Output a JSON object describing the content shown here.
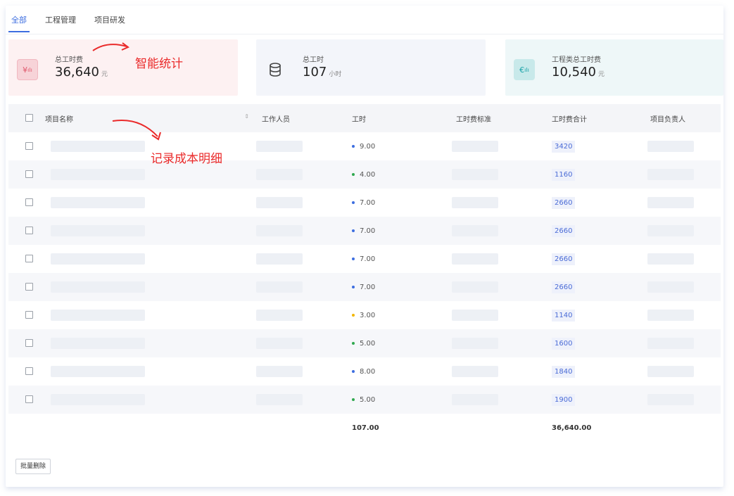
{
  "tabs": [
    "全部",
    "工程管理",
    "项目研发"
  ],
  "stats": [
    {
      "label": "总工时费",
      "value": "36,640",
      "unit": "元",
      "icon": "finance-icon"
    },
    {
      "label": "总工时",
      "value": "107",
      "unit": "小时",
      "icon": "database-icon"
    },
    {
      "label": "工程类总工时费",
      "value": "10,540",
      "unit": "元",
      "icon": "cost-trend-icon"
    }
  ],
  "table": {
    "columns": [
      "项目名称",
      "工作人员",
      "工时",
      "工时费标准",
      "工时费合计",
      "项目负责人"
    ],
    "rows": [
      {
        "hours": "9.00",
        "dot": "#3d6ee0",
        "total": "3420"
      },
      {
        "hours": "4.00",
        "dot": "#2fa84f",
        "total": "1160"
      },
      {
        "hours": "7.00",
        "dot": "#3d6ee0",
        "total": "2660"
      },
      {
        "hours": "7.00",
        "dot": "#3d6ee0",
        "total": "2660"
      },
      {
        "hours": "7.00",
        "dot": "#3d6ee0",
        "total": "2660"
      },
      {
        "hours": "7.00",
        "dot": "#3d6ee0",
        "total": "2660"
      },
      {
        "hours": "3.00",
        "dot": "#f2b600",
        "total": "1140"
      },
      {
        "hours": "5.00",
        "dot": "#2fa84f",
        "total": "1600"
      },
      {
        "hours": "8.00",
        "dot": "#3d6ee0",
        "total": "1840"
      },
      {
        "hours": "5.00",
        "dot": "#2fa84f",
        "total": "1900"
      }
    ],
    "footer": {
      "hours": "107.00",
      "total": "36,640.00"
    }
  },
  "batch_delete": "批量删除",
  "annotations": {
    "stats": "智能统计",
    "details": "记录成本明细"
  },
  "colors": {
    "accent": "#3d6ee0",
    "annotation": "#ea2a2a"
  }
}
